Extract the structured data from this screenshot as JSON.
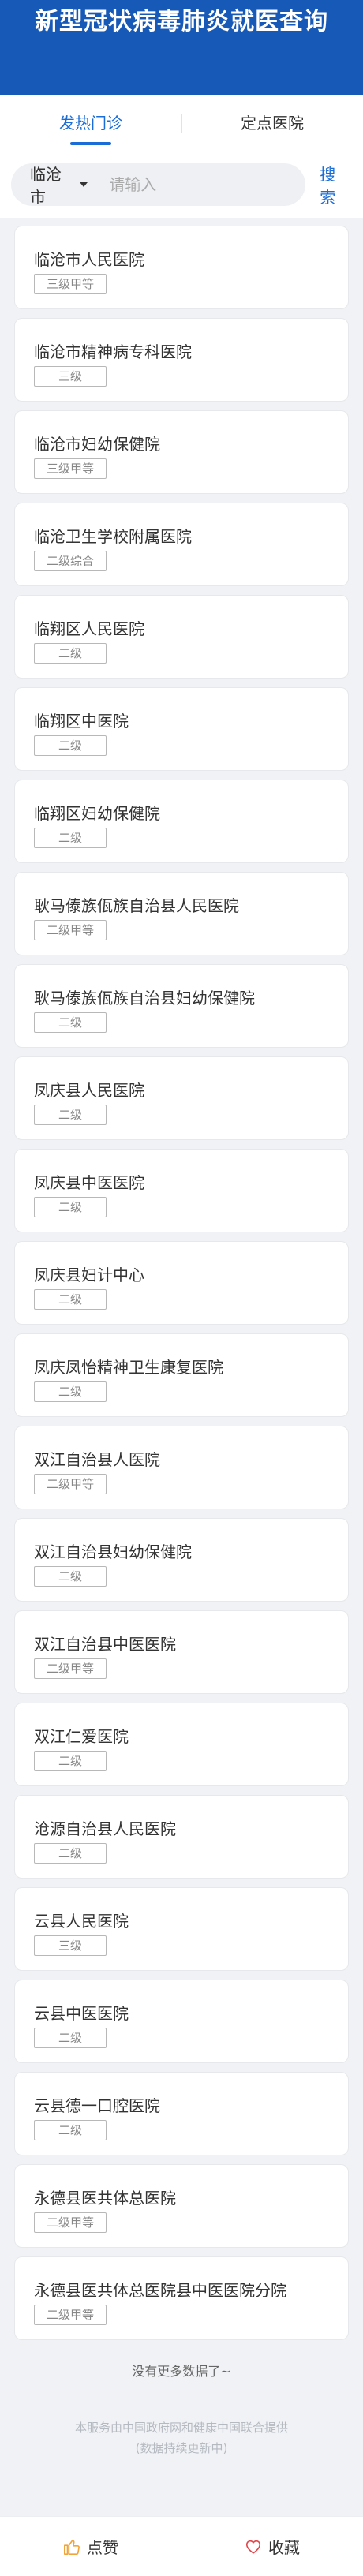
{
  "header": {
    "title": "新型冠状病毒肺炎就医查询"
  },
  "tabs": [
    {
      "label": "发热门诊"
    },
    {
      "label": "定点医院"
    }
  ],
  "search": {
    "city": "临沧市",
    "placeholder": "请输入",
    "value": "",
    "button_label": "搜索"
  },
  "hospitals": [
    {
      "name": "临沧市人民医院",
      "level": "三级甲等"
    },
    {
      "name": "临沧市精神病专科医院",
      "level": "三级"
    },
    {
      "name": "临沧市妇幼保健院",
      "level": "三级甲等"
    },
    {
      "name": "临沧卫生学校附属医院",
      "level": "二级综合"
    },
    {
      "name": "临翔区人民医院",
      "level": "二级"
    },
    {
      "name": "临翔区中医院",
      "level": "二级"
    },
    {
      "name": "临翔区妇幼保健院",
      "level": "二级"
    },
    {
      "name": "耿马傣族佤族自治县人民医院",
      "level": "二级甲等"
    },
    {
      "name": "耿马傣族佤族自治县妇幼保健院",
      "level": "二级"
    },
    {
      "name": "凤庆县人民医院",
      "level": "二级"
    },
    {
      "name": "凤庆县中医医院",
      "level": "二级"
    },
    {
      "name": "凤庆县妇计中心",
      "level": "二级"
    },
    {
      "name": "凤庆凤怡精神卫生康复医院",
      "level": "二级"
    },
    {
      "name": "双江自治县人医院",
      "level": "二级甲等"
    },
    {
      "name": "双江自治县妇幼保健院",
      "level": "二级"
    },
    {
      "name": "双江自治县中医医院",
      "level": "二级甲等"
    },
    {
      "name": "双江仁爱医院",
      "level": "二级"
    },
    {
      "name": "沧源自治县人民医院",
      "level": "二级"
    },
    {
      "name": "云县人民医院",
      "level": "三级"
    },
    {
      "name": "云县中医医院",
      "level": "二级"
    },
    {
      "name": "云县德一口腔医院",
      "level": "二级"
    },
    {
      "name": "永德县医共体总医院",
      "level": "二级甲等"
    },
    {
      "name": "永德县医共体总医院县中医医院分院",
      "level": "二级甲等"
    }
  ],
  "list_end": "没有更多数据了~",
  "footer": {
    "line1": "本服务由中国政府网和健康中国联合提供",
    "line2": "(数据持续更新中)"
  },
  "bottom_bar": {
    "like_label": "点赞",
    "like_icon": "thumbs-up-icon",
    "favorite_label": "收藏",
    "favorite_icon": "heart-icon"
  },
  "colors": {
    "header_bg": "#1759b6",
    "accent": "#1a6dd6",
    "like_icon": "#f0a43a",
    "heart_icon": "#e0464b"
  }
}
